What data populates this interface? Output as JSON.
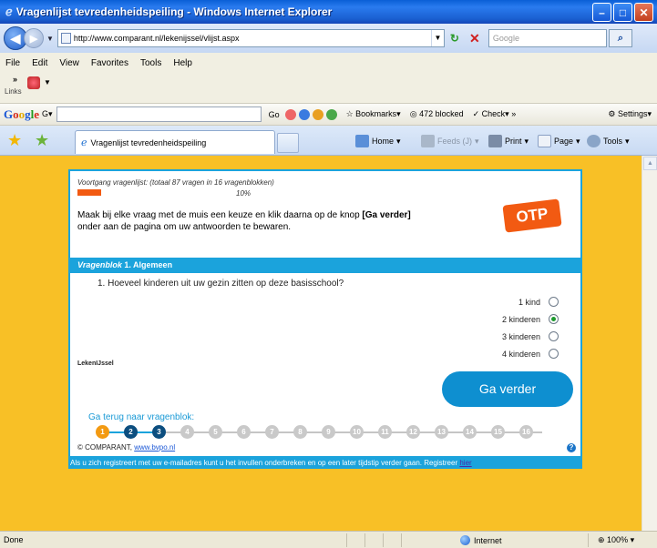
{
  "window": {
    "title": "Vragenlijst tevredenheidspeiling - Windows Internet Explorer"
  },
  "address_bar": {
    "url": "http://www.comparant.nl/lekenijssel/vlijst.aspx",
    "search_placeholder": "Google"
  },
  "menu": [
    "File",
    "Edit",
    "View",
    "Favorites",
    "Tools",
    "Help"
  ],
  "links_bar": {
    "label": "Links"
  },
  "google_toolbar": {
    "go_label": "Go",
    "bookmarks_label": "Bookmarks",
    "blocked_label": "472 blocked",
    "check_label": "Check",
    "settings_label": "Settings"
  },
  "tab": {
    "title": "Vragenlijst tevredenheidspeiling"
  },
  "command_bar": {
    "home": "Home",
    "feeds": "Feeds (J)",
    "print": "Print",
    "page": "Page",
    "tools": "Tools"
  },
  "survey": {
    "progress_label": "Voortgang vragenlijst: (totaal 87 vragen in 16 vragenblokken)",
    "progress_percent": "10%",
    "progress_value": 0.1,
    "instruction_line1_pre": "Maak bij elke vraag met de muis een keuze en klik daarna op de knop ",
    "instruction_button_ref": "[Ga verder]",
    "instruction_line2": "onder aan de pagina om uw antwoorden te bewaren.",
    "logo_text": "OTP",
    "block_prefix": "Vragenblok",
    "block_title": "1. Algemeen",
    "question": "1. Hoeveel kinderen uit uw gezin zitten op deze basisschool?",
    "options": [
      {
        "label": "1 kind",
        "selected": false
      },
      {
        "label": "2 kinderen",
        "selected": true
      },
      {
        "label": "3 kinderen",
        "selected": false
      },
      {
        "label": "4 kinderen",
        "selected": false
      }
    ],
    "school_name": "LekenIJssel",
    "continue_button": "Ga verder",
    "back_label": "Ga terug naar vragenblok:",
    "steps": [
      "1",
      "2",
      "3",
      "4",
      "5",
      "6",
      "7",
      "8",
      "9",
      "10",
      "11",
      "12",
      "13",
      "14",
      "15",
      "16"
    ],
    "current_step": 1,
    "completed_steps": [
      2,
      3
    ],
    "copyright_prefix": "© COMPARANT,",
    "copyright_link": "www.bvpo.nl",
    "register_text": "Als u zich registreert met uw e-mailadres kunt u het invullen onderbreken en op een later tijdstip verder gaan. Registreer",
    "register_link": "hier"
  },
  "status_bar": {
    "status": "Done",
    "zone": "Internet",
    "zoom": "100%"
  },
  "colors": {
    "page_background": "#f8c026",
    "accent_blue": "#1ba3dc",
    "accent_orange": "#f25a12",
    "step_current": "#f39a12",
    "step_done": "#0c4e7f"
  }
}
